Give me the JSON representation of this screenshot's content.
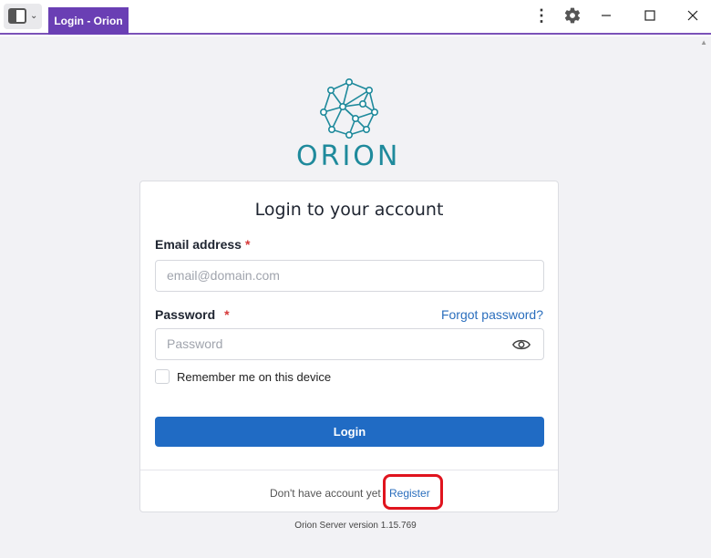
{
  "window": {
    "tab_title": "Login - Orion",
    "accent_color": "#6a3fb4",
    "icons": [
      "sidebar-toggle-icon",
      "kebab-menu-icon",
      "gear-icon",
      "minimize-icon",
      "maximize-icon",
      "close-icon"
    ]
  },
  "brand": {
    "name": "ORION",
    "color": "#1f8a9c"
  },
  "login": {
    "title": "Login to your account",
    "email_label": "Email address",
    "required_mark": "*",
    "email_placeholder": "email@domain.com",
    "password_label": "Password",
    "forgot_link": "Forgot password?",
    "password_placeholder": "Password",
    "remember_label": "Remember me on this device",
    "submit_label": "Login",
    "button_color": "#206bc4"
  },
  "footer": {
    "prompt": "Don't have account yet",
    "register_link": "Register",
    "highlight_color": "#e0141e"
  },
  "version_text": "Orion Server version 1.15.769"
}
